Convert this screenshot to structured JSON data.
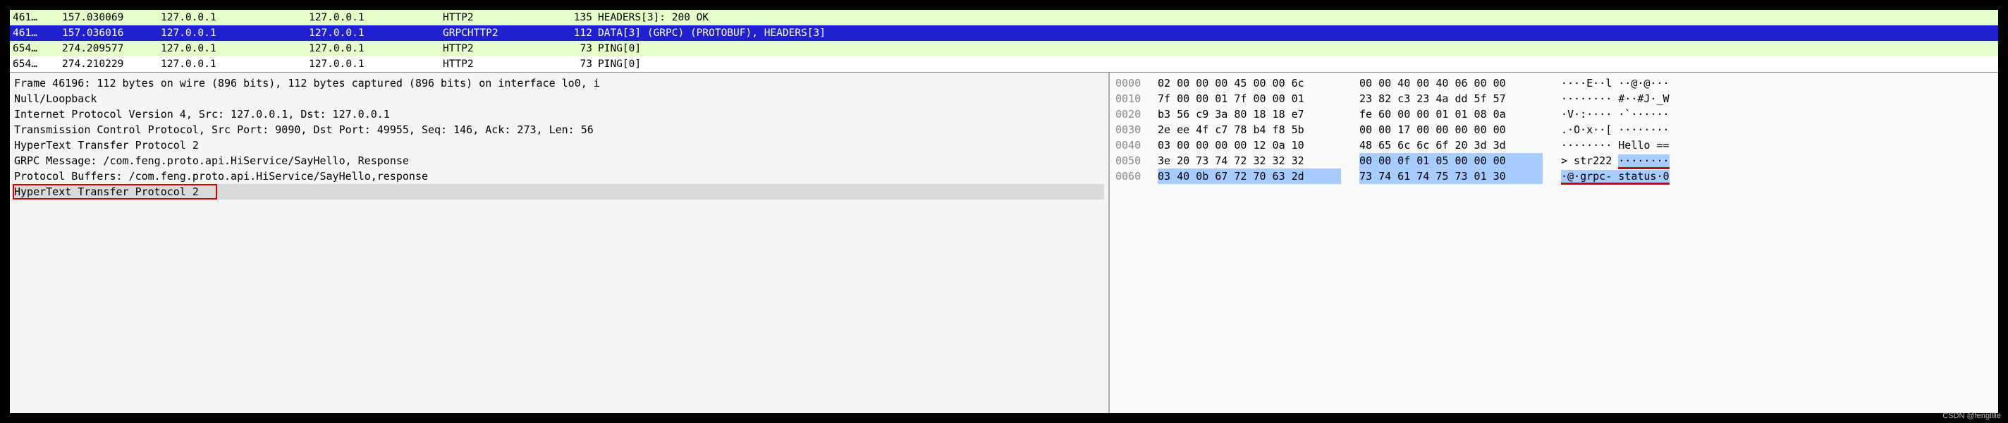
{
  "packet_list": [
    {
      "no": "461…",
      "time": "157.030069",
      "src": "127.0.0.1",
      "dst": "127.0.0.1",
      "proto": "HTTP2",
      "len": "135",
      "info": "HEADERS[3]: 200 OK",
      "style": "green"
    },
    {
      "no": "461…",
      "time": "157.036016",
      "src": "127.0.0.1",
      "dst": "127.0.0.1",
      "proto": "GRPCHTTP2",
      "len": "112",
      "info": "DATA[3] (GRPC) (PROTOBUF), HEADERS[3]",
      "style": "blue"
    },
    {
      "no": "654…",
      "time": "274.209577",
      "src": "127.0.0.1",
      "dst": "127.0.0.1",
      "proto": "HTTP2",
      "len": "73",
      "info": "PING[0]",
      "style": "green"
    },
    {
      "no": "654…",
      "time": "274.210229",
      "src": "127.0.0.1",
      "dst": "127.0.0.1",
      "proto": "HTTP2",
      "len": "73",
      "info": "PING[0]",
      "style": "white"
    }
  ],
  "detail_lines": [
    {
      "text": "Frame 46196: 112 bytes on wire (896 bits), 112 bytes captured (896 bits) on interface lo0, i",
      "sel": false
    },
    {
      "text": "Null/Loopback",
      "sel": false
    },
    {
      "text": "Internet Protocol Version 4, Src: 127.0.0.1, Dst: 127.0.0.1",
      "sel": false
    },
    {
      "text": "Transmission Control Protocol, Src Port: 9090, Dst Port: 49955, Seq: 146, Ack: 273, Len: 56",
      "sel": false
    },
    {
      "text": "HyperText Transfer Protocol 2",
      "sel": false
    },
    {
      "text": "GRPC Message: /com.feng.proto.api.HiService/SayHello, Response",
      "sel": false
    },
    {
      "text": "Protocol Buffers: /com.feng.proto.api.HiService/SayHello,response",
      "sel": false
    },
    {
      "text": "HyperText Transfer Protocol 2",
      "sel": true
    }
  ],
  "hex_rows": [
    {
      "offset": "0000",
      "b1": "02 00 00 00 45 00 00 6c",
      "b2": "00 00 40 00 40 06 00 00",
      "asc": "····E··l ··@·@···",
      "hl1": "",
      "hl2": ""
    },
    {
      "offset": "0010",
      "b1": "7f 00 00 01 7f 00 00 01",
      "b2": "23 82 c3 23 4a dd 5f 57",
      "asc": "········ #··#J·_W",
      "hl1": "",
      "hl2": ""
    },
    {
      "offset": "0020",
      "b1": "b3 56 c9 3a 80 18 18 e7",
      "b2": "fe 60 00 00 01 01 08 0a",
      "asc": "·V·:···· ·`······",
      "hl1": "",
      "hl2": ""
    },
    {
      "offset": "0030",
      "b1": "2e ee 4f c7 78 b4 f8 5b",
      "b2": "00 00 17 00 00 00 00 00",
      "asc": ".·O·x··[ ········",
      "hl1": "",
      "hl2": ""
    },
    {
      "offset": "0040",
      "b1": "03 00 00 00 00 12 0a 10",
      "b2": "48 65 6c 6c 6f 20 3d 3d",
      "asc": "········ Hello ==",
      "hl1": "",
      "hl2": ""
    },
    {
      "offset": "0050",
      "b1": "3e 20 73 74 72 32 32 32",
      "b2": "00 00 0f 01 05 00 00 00",
      "asc": "> str222 ········",
      "hl1": "",
      "hl2": "b2",
      "asc_hl_start": 9
    },
    {
      "offset": "0060",
      "b1": "03 40 0b 67 72 70 63 2d",
      "b2": "73 74 61 74 75 73 01 30",
      "asc": "·@·grpc- status·0",
      "hl1": "b1",
      "hl2": "b2",
      "asc_hl_start": 0
    }
  ],
  "watermark": "CSDN @fenglllle"
}
